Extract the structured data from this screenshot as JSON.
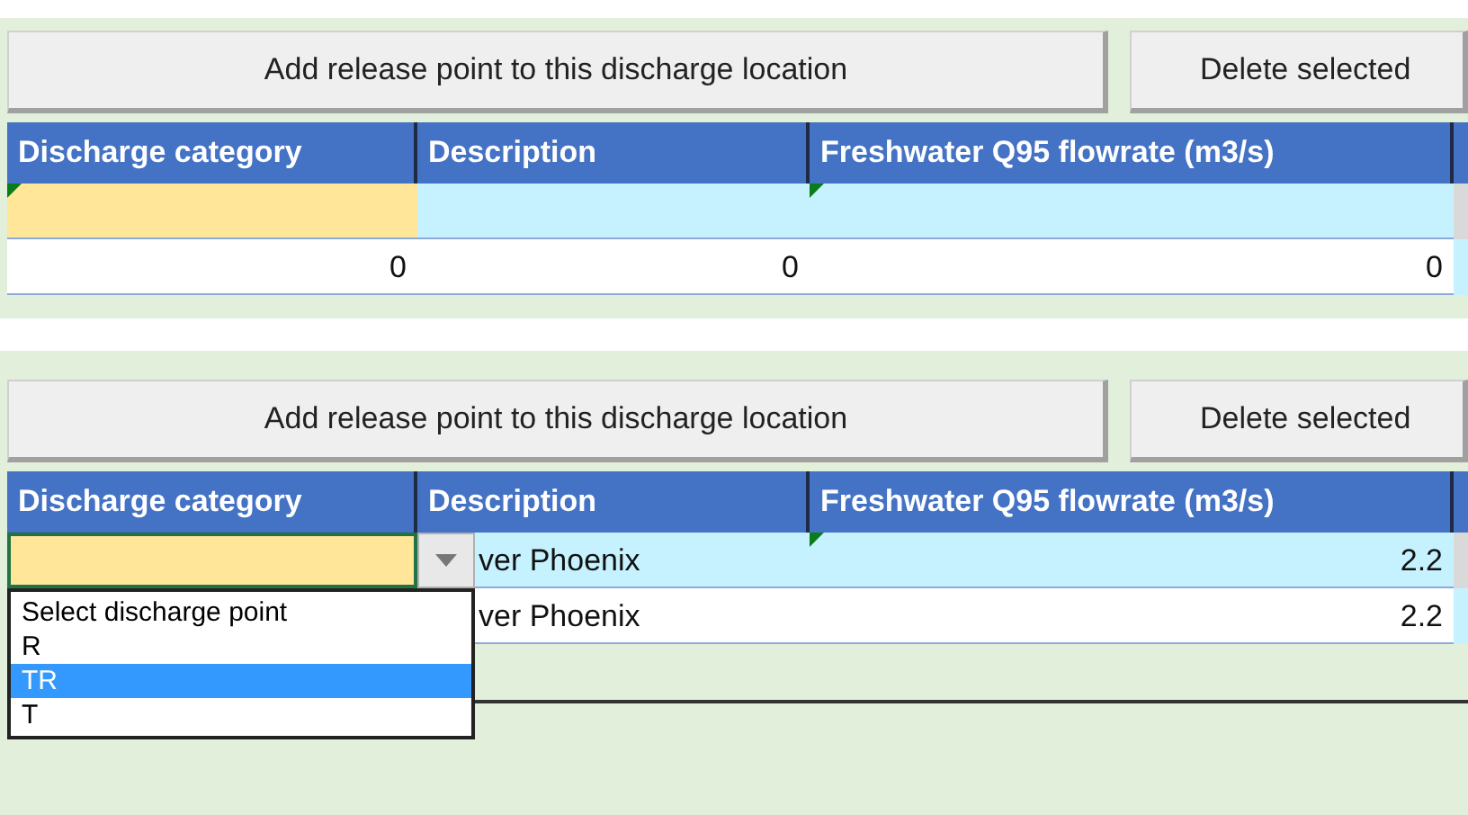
{
  "sections": [
    {
      "buttons": [
        {
          "label": "Add release point to this discharge location"
        },
        {
          "label": "Delete selected"
        }
      ],
      "columns": [
        {
          "label": "Discharge category",
          "marked": true
        },
        {
          "label": "Description",
          "marked": false
        },
        {
          "label": "Freshwater Q95 flowrate (m3/s)",
          "marked": true
        }
      ],
      "rows": [
        {
          "kind": "input",
          "active": false
        },
        {
          "kind": "value",
          "active": false,
          "category": "0",
          "description": "0",
          "flowrate": "0"
        }
      ]
    },
    {
      "buttons": [
        {
          "label": "Add release point to this discharge location"
        },
        {
          "label": "Delete selected"
        }
      ],
      "columns": [
        {
          "label": "Discharge category",
          "marked": false
        },
        {
          "label": "Description",
          "marked": false
        },
        {
          "label": "Freshwater Q95 flowrate (m3/s)",
          "marked": true
        }
      ],
      "rows": [
        {
          "kind": "input",
          "active": true,
          "description": "ver Phoenix",
          "flowrate": "2.2"
        },
        {
          "kind": "value",
          "description": "ver Phoenix",
          "flowrate": "2.2"
        }
      ],
      "dropdown": {
        "items": [
          {
            "label": "Select discharge point",
            "selected": false
          },
          {
            "label": "R",
            "selected": false
          },
          {
            "label": "TR",
            "selected": true
          },
          {
            "label": "T",
            "selected": false
          }
        ]
      }
    }
  ]
}
